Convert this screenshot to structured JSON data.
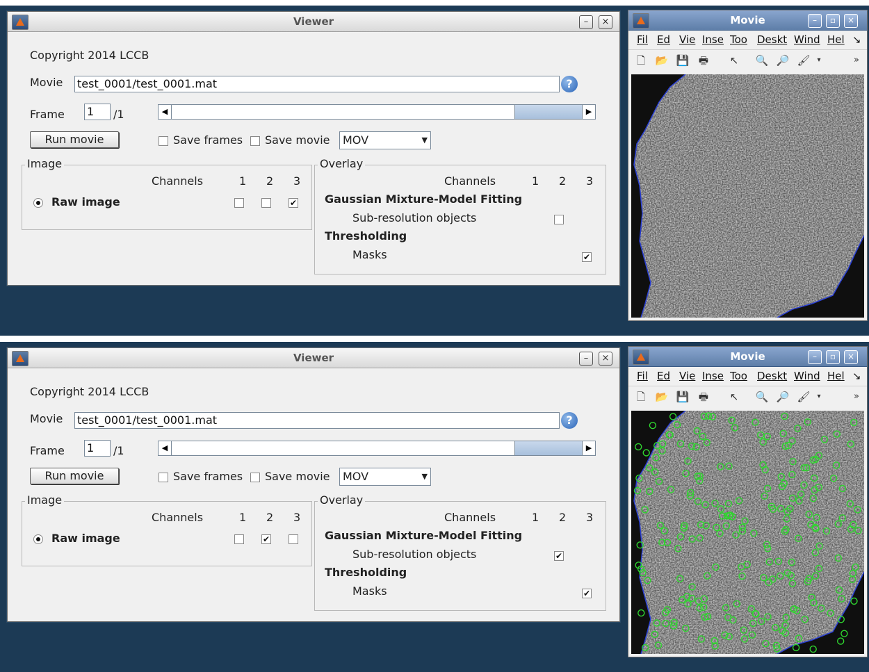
{
  "screens": [
    {
      "viewer": {
        "title": "Viewer",
        "copyright": "Copyright 2014 LCCB",
        "movie_label": "Movie",
        "movie_path": "test_0001/test_0001.mat",
        "help": "?",
        "frame_label": "Frame",
        "frame_value": "1",
        "frame_total": "/1",
        "run_movie": "Run movie",
        "save_frames": "Save frames",
        "save_movie": "Save movie",
        "format": "MOV",
        "image_group": "Image",
        "overlay_group": "Overlay",
        "channels": "Channels",
        "ch1": "1",
        "ch2": "2",
        "ch3": "3",
        "raw_image": "Raw image",
        "image_channels_checked": [
          false,
          false,
          true
        ],
        "gmm_title": "Gaussian Mixture-Model Fitting",
        "subres": "Sub-resolution objects",
        "subres_checked": false,
        "threshold_title": "Thresholding",
        "masks": "Masks",
        "masks_checked": true
      },
      "movie": {
        "title": "Movie",
        "menus": [
          "Fil",
          "Ed",
          "Vie",
          "Inse",
          "Too",
          "Deskt",
          "Wind",
          "Hel"
        ],
        "overlay_circles": false
      }
    },
    {
      "viewer": {
        "title": "Viewer",
        "copyright": "Copyright 2014 LCCB",
        "movie_label": "Movie",
        "movie_path": "test_0001/test_0001.mat",
        "help": "?",
        "frame_label": "Frame",
        "frame_value": "1",
        "frame_total": "/1",
        "run_movie": "Run movie",
        "save_frames": "Save frames",
        "save_movie": "Save movie",
        "format": "MOV",
        "image_group": "Image",
        "overlay_group": "Overlay",
        "channels": "Channels",
        "ch1": "1",
        "ch2": "2",
        "ch3": "3",
        "raw_image": "Raw image",
        "image_channels_checked": [
          false,
          true,
          false
        ],
        "gmm_title": "Gaussian Mixture-Model Fitting",
        "subres": "Sub-resolution objects",
        "subres_checked": true,
        "threshold_title": "Thresholding",
        "masks": "Masks",
        "masks_checked": true
      },
      "movie": {
        "title": "Movie",
        "menus": [
          "Fil",
          "Ed",
          "Vie",
          "Inse",
          "Too",
          "Deskt",
          "Wind",
          "Hel"
        ],
        "overlay_circles": true
      }
    }
  ],
  "colors": {
    "desktop": "#1c3a55",
    "mask_outline": "#2a3fd4",
    "detection": "#2fd62f"
  }
}
